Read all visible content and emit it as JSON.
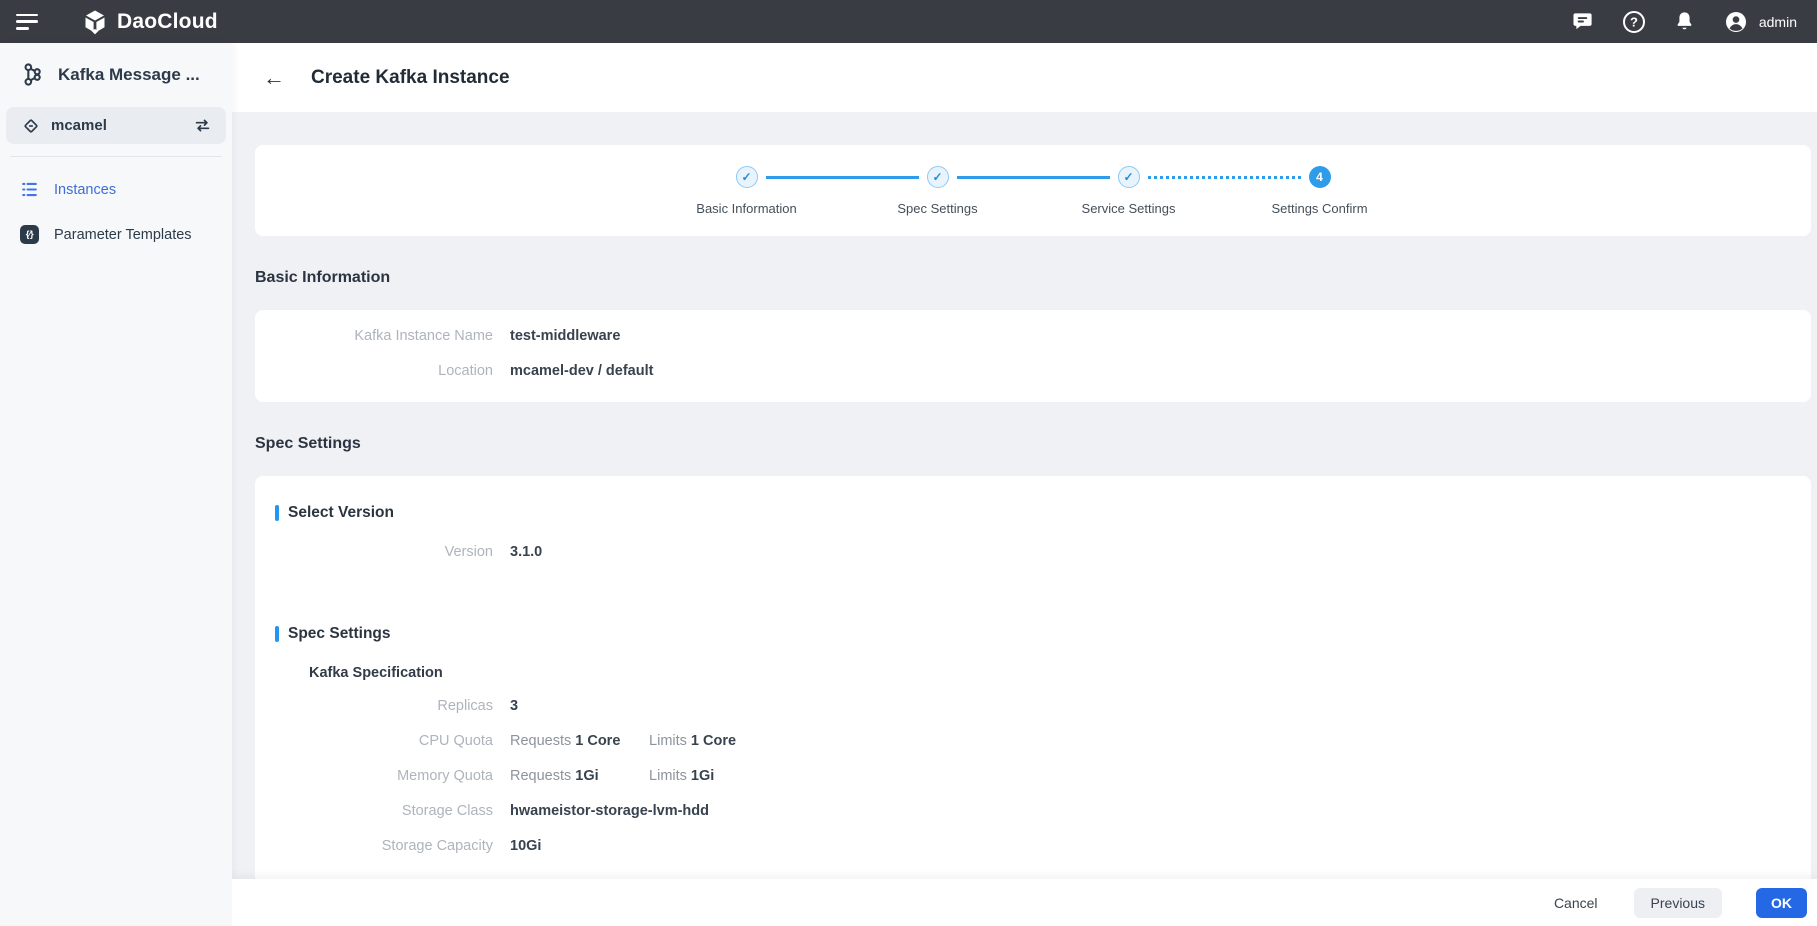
{
  "topbar": {
    "brand": "DaoCloud",
    "user": "admin",
    "icons": [
      "menu-icon",
      "daocloud-logo-icon",
      "chat-icon",
      "help-icon",
      "bell-icon",
      "user-avatar-icon"
    ]
  },
  "sidebar": {
    "app_title": "Kafka Message ...",
    "workspace": "mcamel",
    "nav": [
      {
        "label": "Instances",
        "active": true,
        "icon": "list-icon"
      },
      {
        "label": "Parameter Templates",
        "active": false,
        "icon": "braces-icon"
      }
    ]
  },
  "page_header": {
    "title": "Create Kafka Instance",
    "back_icon": "arrow-left-icon"
  },
  "stepper": {
    "steps": [
      {
        "label": "Basic Information",
        "status": "done"
      },
      {
        "label": "Spec Settings",
        "status": "done"
      },
      {
        "label": "Service Settings",
        "status": "done"
      },
      {
        "label": "Settings Confirm",
        "status": "active",
        "number": "4"
      }
    ],
    "check_glyph": "✓"
  },
  "basic_info": {
    "section_title": "Basic Information",
    "rows": [
      {
        "label": "Kafka Instance Name",
        "value": "test-middleware"
      },
      {
        "label": "Location",
        "value": "mcamel-dev / default"
      }
    ]
  },
  "spec": {
    "section_title": "Spec Settings",
    "select_version": {
      "title": "Select Version",
      "rows": [
        {
          "label": "Version",
          "value": "3.1.0"
        }
      ]
    },
    "spec_settings": {
      "title": "Spec Settings",
      "group_title": "Kafka Specification",
      "rows": [
        {
          "label": "Replicas",
          "value": "3"
        },
        {
          "label": "CPU Quota",
          "req_label": "Requests",
          "req_value": "1 Core",
          "lim_label": "Limits",
          "lim_value": "1 Core"
        },
        {
          "label": "Memory Quota",
          "req_label": "Requests",
          "req_value": "1Gi",
          "lim_label": "Limits",
          "lim_value": "1Gi"
        },
        {
          "label": "Storage Class",
          "value": "hwameistor-storage-lvm-hdd"
        },
        {
          "label": "Storage Capacity",
          "value": "10Gi"
        }
      ]
    }
  },
  "footer": {
    "cancel": "Cancel",
    "previous": "Previous",
    "ok": "OK"
  },
  "colors": {
    "topbar_bg": "#393d43",
    "sidebar_bg": "#f7f8fa",
    "page_bg": "#eff1f4",
    "stepper_blue": "#2e9ceb",
    "accent_blue": "#2196f3",
    "ok_button_blue": "#2468e5",
    "active_link_blue": "#3f6ed4",
    "title_text": "#2b3541",
    "value_text": "#39434f",
    "label_text": "#aeb4bc"
  }
}
